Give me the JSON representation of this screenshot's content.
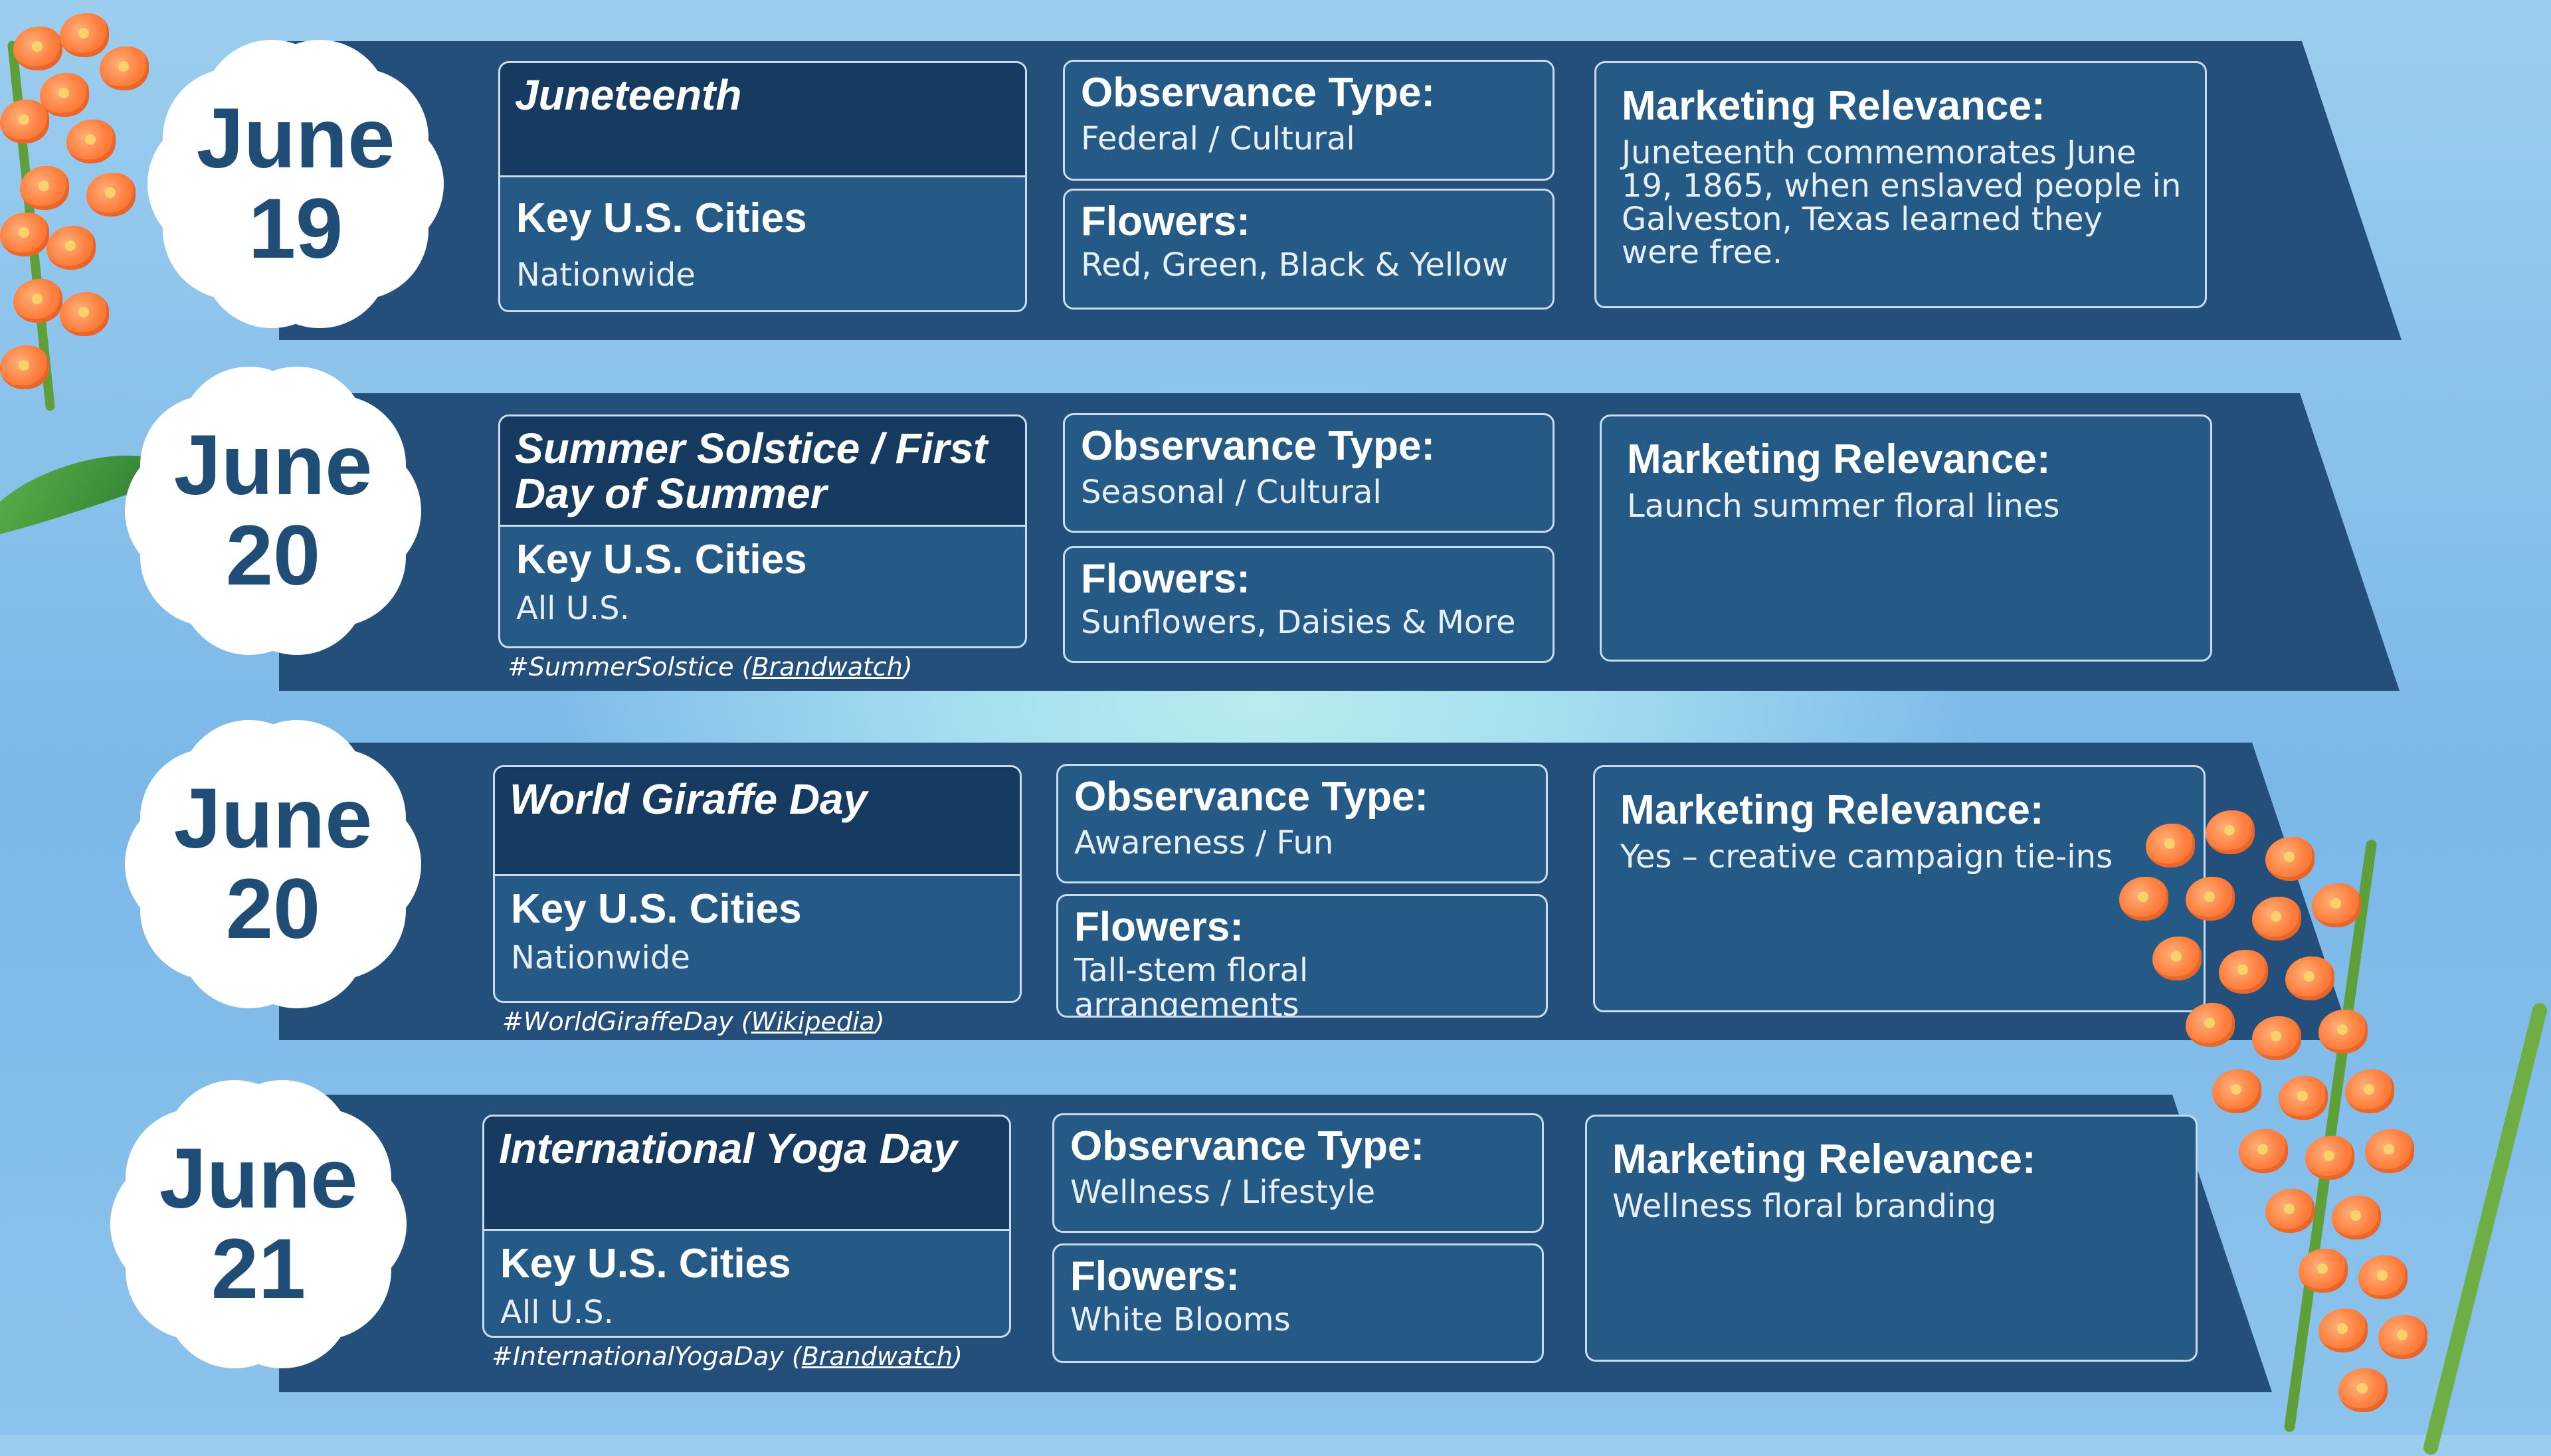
{
  "rows": [
    {
      "month": "June",
      "day": "19",
      "title": "Juneteenth",
      "cities_label": "Key U.S. Cities",
      "cities_value": "Nationwide",
      "hashtag": "",
      "hashtag_source": "",
      "observance_label": "Observance Type:",
      "observance_value": "Federal / Cultural",
      "flowers_label": "Flowers:",
      "flowers_value": "Red, Green, Black & Yellow",
      "marketing_label": "Marketing Relevance:",
      "marketing_value": "Juneteenth commemorates June 19, 1865, when enslaved people in Galveston, Texas learned they were free."
    },
    {
      "month": "June",
      "day": "20",
      "title": "Summer Solstice / First Day of Summer",
      "cities_label": "Key U.S. Cities",
      "cities_value": "All U.S.",
      "hashtag": "#SummerSolstice (",
      "hashtag_source": "Brandwatch",
      "hashtag_end": ")",
      "observance_label": "Observance Type:",
      "observance_value": "Seasonal / Cultural",
      "flowers_label": "Flowers:",
      "flowers_value": "Sunflowers, Daisies & More",
      "marketing_label": "Marketing Relevance:",
      "marketing_value": "Launch summer floral lines"
    },
    {
      "month": "June",
      "day": "20",
      "title": "World Giraffe Day",
      "cities_label": "Key U.S. Cities",
      "cities_value": "Nationwide",
      "hashtag": "#WorldGiraffeDay (",
      "hashtag_source": "Wikipedia",
      "hashtag_end": ")",
      "observance_label": "Observance Type:",
      "observance_value": "Awareness / Fun",
      "flowers_label": "Flowers:",
      "flowers_value": "Tall-stem floral arrangements",
      "marketing_label": "Marketing Relevance:",
      "marketing_value": "Yes – creative campaign tie-ins"
    },
    {
      "month": "June",
      "day": "21",
      "title": "International Yoga Day",
      "cities_label": "Key U.S. Cities",
      "cities_value": "All U.S.",
      "hashtag": "#InternationalYogaDay (",
      "hashtag_source": "Brandwatch",
      "hashtag_end": ")",
      "observance_label": "Observance Type:",
      "observance_value": "Wellness / Lifestyle",
      "flowers_label": "Flowers:",
      "flowers_value": "White Blooms",
      "marketing_label": "Marketing Relevance:",
      "marketing_value": "Wellness floral branding"
    }
  ],
  "colors": {
    "banner": "#234f7a",
    "title_bar": "#163a60",
    "box": "#255a87",
    "date_text": "#1f4d76",
    "background": "#8cc3ec"
  },
  "icons": {
    "decoration_left": "orange-orchid-flowers",
    "decoration_right": "orange-orchid-flowers",
    "leaf": "green-leaf"
  }
}
